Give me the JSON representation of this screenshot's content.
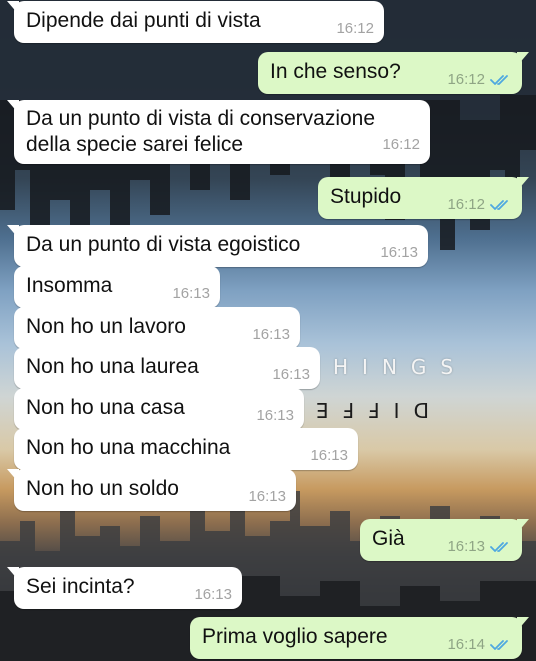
{
  "wallpaper": {
    "words": [
      "HINGS",
      "DIFFE"
    ]
  },
  "messages": [
    {
      "dir": "in",
      "text": "Dipende dai punti di vista",
      "time": "16:12"
    },
    {
      "dir": "out",
      "text": "In che senso?",
      "time": "16:12",
      "read": true
    },
    {
      "dir": "in",
      "text": "Da un punto di vista di conservazione della specie sarei felice",
      "time": "16:12"
    },
    {
      "dir": "out",
      "text": "Stupido",
      "time": "16:12",
      "read": true
    },
    {
      "dir": "in",
      "text": "Da un punto di vista egoistico",
      "time": "16:13"
    },
    {
      "dir": "in",
      "text": "Insomma",
      "time": "16:13"
    },
    {
      "dir": "in",
      "text": "Non ho un lavoro",
      "time": "16:13"
    },
    {
      "dir": "in",
      "text": "Non ho una laurea",
      "time": "16:13"
    },
    {
      "dir": "in",
      "text": "Non ho una casa",
      "time": "16:13"
    },
    {
      "dir": "in",
      "text": "Non ho una macchina",
      "time": "16:13"
    },
    {
      "dir": "in",
      "text": "Non ho un soldo",
      "time": "16:13"
    },
    {
      "dir": "out",
      "text": "Già",
      "time": "16:13",
      "read": true
    },
    {
      "dir": "in",
      "text": "Sei incinta?",
      "time": "16:13"
    },
    {
      "dir": "out",
      "text": "Prima voglio sapere",
      "time": "16:14",
      "read": true
    }
  ],
  "colors": {
    "incoming_bubble": "#ffffff",
    "outgoing_bubble": "#dcf8c6",
    "read_ticks": "#4fa8e0"
  }
}
